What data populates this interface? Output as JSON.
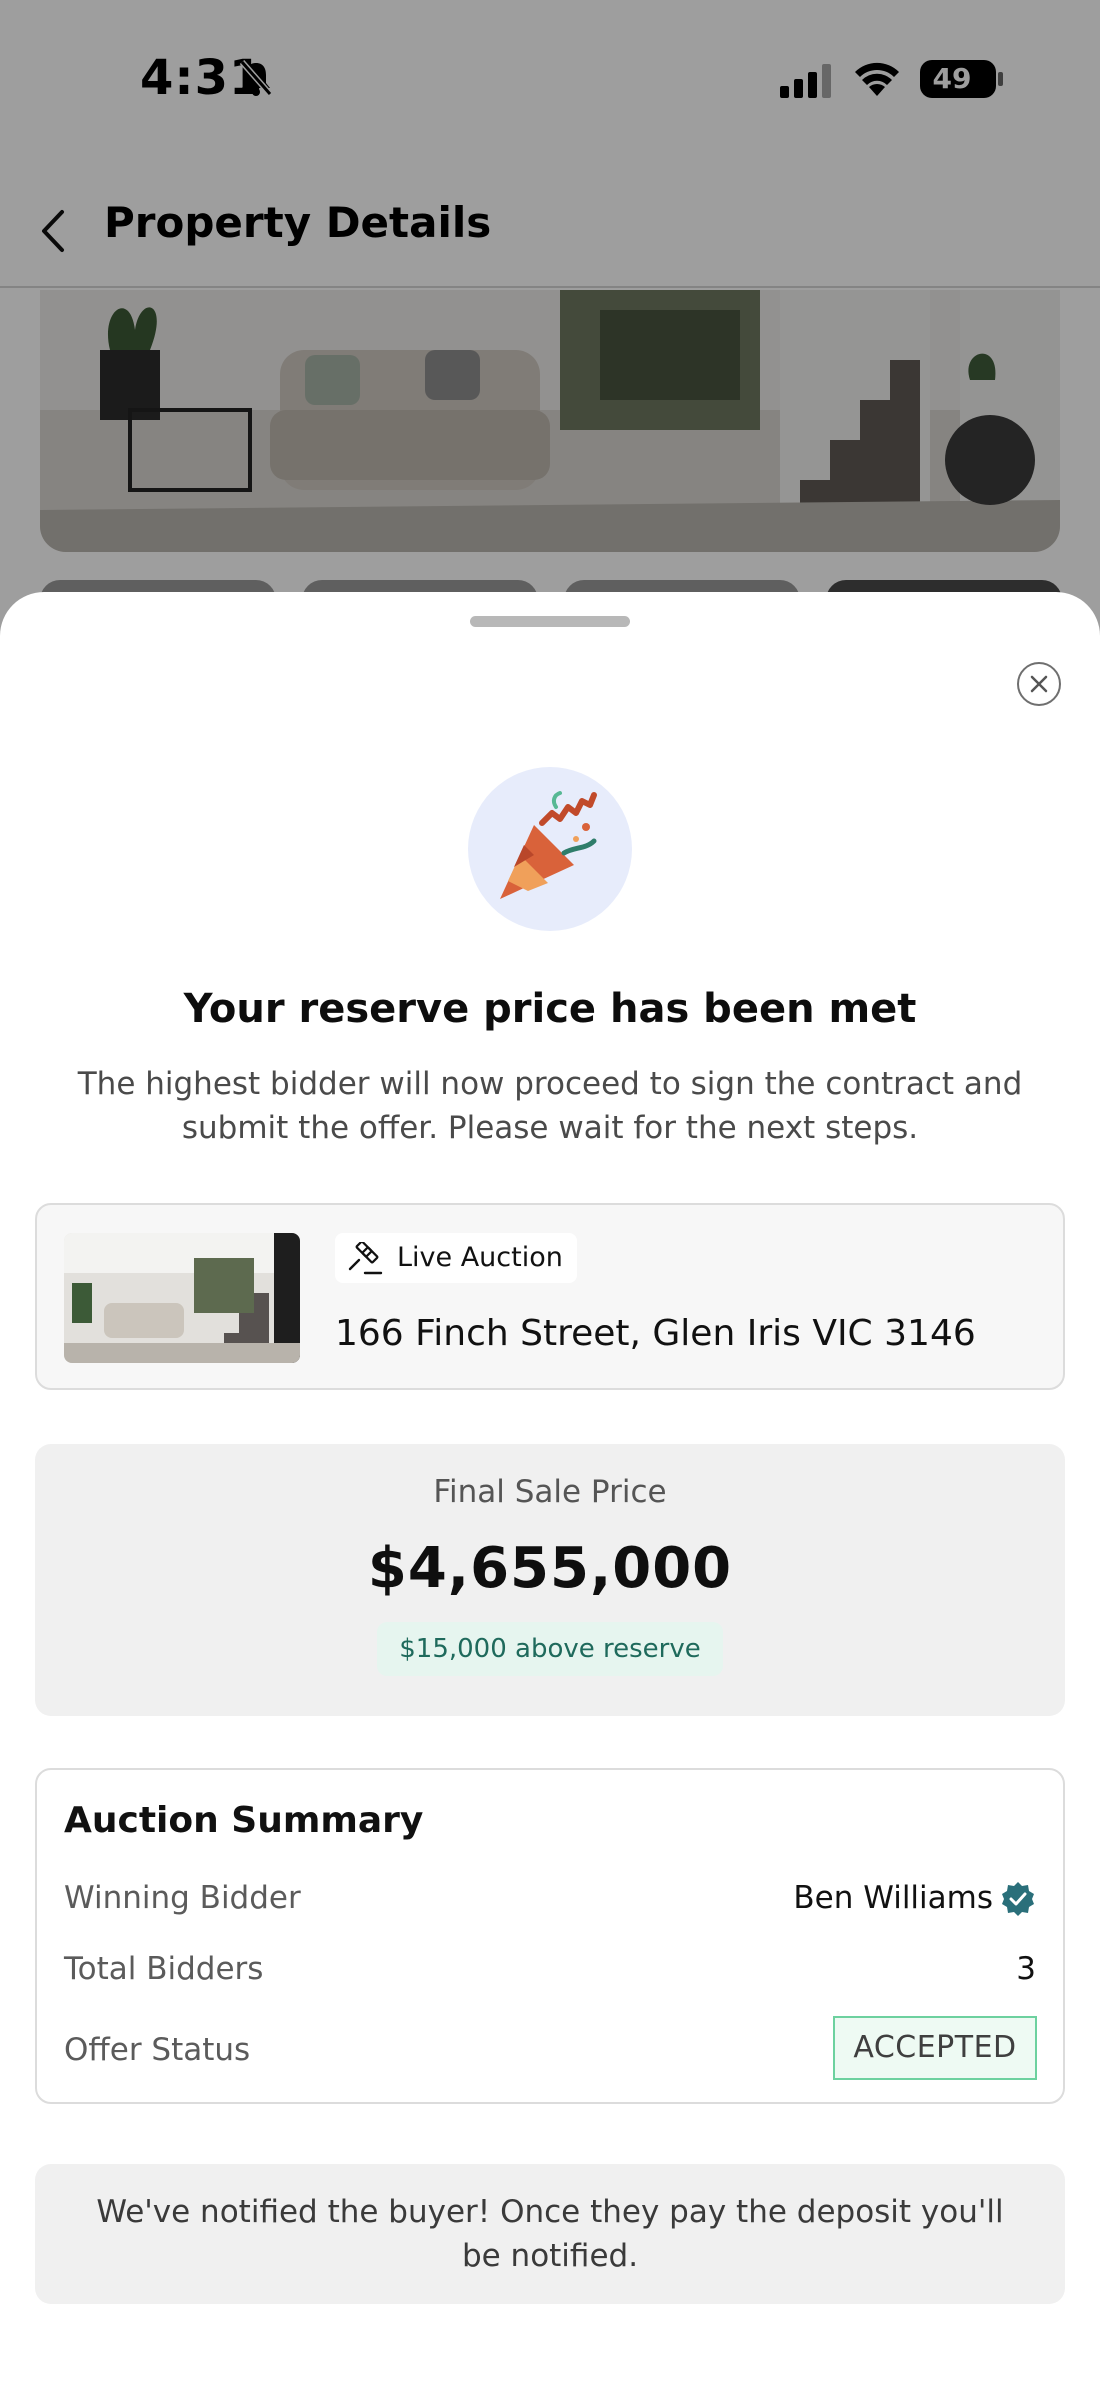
{
  "status_bar": {
    "time": "4:31",
    "battery": "49"
  },
  "nav": {
    "title": "Property Details"
  },
  "modal": {
    "headline": "Your reserve price has been met",
    "subtext": "The highest bidder will now proceed to sign the contract and submit the offer. Please wait for the next steps.",
    "property": {
      "badge": "Live Auction",
      "address": "166 Finch Street, Glen Iris VIC 3146"
    },
    "price": {
      "label": "Final Sale Price",
      "value": "$4,655,000",
      "above_reserve": "$15,000 above reserve"
    },
    "summary": {
      "title": "Auction Summary",
      "rows": [
        {
          "label": "Winning Bidder",
          "value": "Ben Williams"
        },
        {
          "label": "Total Bidders",
          "value": "3"
        },
        {
          "label": "Offer Status",
          "value": "ACCEPTED"
        }
      ]
    },
    "notice": "We've notified the buyer! Once they pay the deposit you'll be notified."
  },
  "colors": {
    "accent_teal": "#2a6f7a",
    "accepted_border": "#6dd19f",
    "reserve_text": "#1f6a5c"
  },
  "icons": [
    "bell-slash-icon",
    "signal-icon",
    "wifi-icon",
    "battery-icon",
    "chevron-left-icon",
    "close-icon",
    "party-popper-icon",
    "gavel-icon",
    "verified-badge-icon"
  ]
}
